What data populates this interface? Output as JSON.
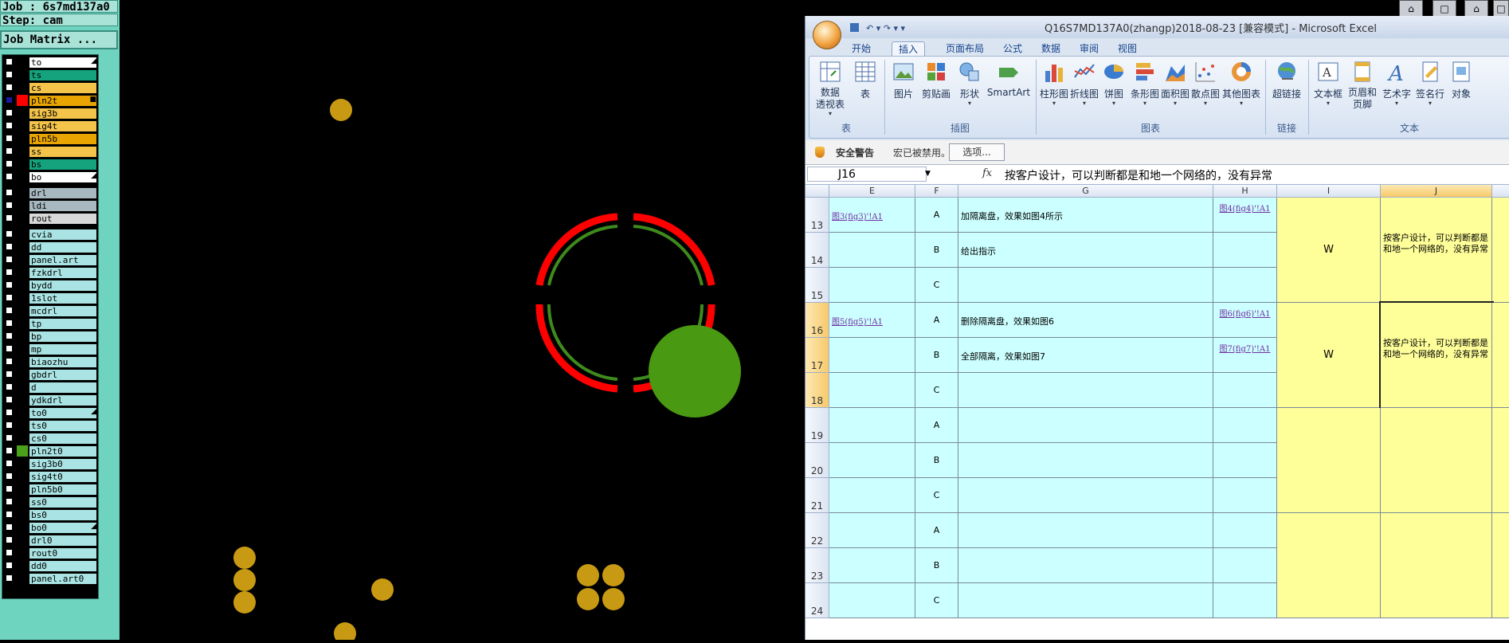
{
  "cam": {
    "job": "Job : 6s7md137a0",
    "step": "Step: cam",
    "job_matrix": "Job Matrix ...",
    "layers": [
      {
        "name": "to",
        "color": "#ffffff",
        "checked": false,
        "swatch": "",
        "arrow": "◢"
      },
      {
        "name": "ts",
        "color": "#14a37d",
        "checked": false,
        "swatch": "",
        "arrow": ""
      },
      {
        "name": "cs",
        "color": "#f3c34a",
        "checked": false,
        "swatch": "",
        "arrow": ""
      },
      {
        "name": "pln2t",
        "color": "#e8a400",
        "checked": true,
        "swatch": "#ff0000",
        "arrow": "■"
      },
      {
        "name": "sig3b",
        "color": "#f3c34a",
        "checked": false,
        "swatch": "",
        "arrow": ""
      },
      {
        "name": "sig4t",
        "color": "#f3c34a",
        "checked": false,
        "swatch": "",
        "arrow": ""
      },
      {
        "name": "pln5b",
        "color": "#e8a400",
        "checked": false,
        "swatch": "",
        "arrow": ""
      },
      {
        "name": "ss",
        "color": "#f3c34a",
        "checked": false,
        "swatch": "",
        "arrow": ""
      },
      {
        "name": "bs",
        "color": "#14a37d",
        "checked": false,
        "swatch": "",
        "arrow": ""
      },
      {
        "name": "bo",
        "color": "#ffffff",
        "checked": false,
        "swatch": "",
        "arrow": "◢"
      },
      {
        "name": "drl",
        "color": "#a8b8c0",
        "checked": false,
        "swatch": "",
        "arrow": ""
      },
      {
        "name": "ldi",
        "color": "#a8b8c0",
        "checked": false,
        "swatch": "",
        "arrow": ""
      },
      {
        "name": "rout",
        "color": "#d8d8d8",
        "checked": false,
        "swatch": "",
        "arrow": ""
      },
      {
        "name": "cvia",
        "color": "#a9e3e3",
        "checked": false,
        "swatch": "",
        "arrow": ""
      },
      {
        "name": "dd",
        "color": "#a9e3e3",
        "checked": false,
        "swatch": "",
        "arrow": ""
      },
      {
        "name": "panel.art",
        "color": "#a9e3e3",
        "checked": false,
        "swatch": "",
        "arrow": ""
      },
      {
        "name": "fzkdrl",
        "color": "#a9e3e3",
        "checked": false,
        "swatch": "",
        "arrow": ""
      },
      {
        "name": "bydd",
        "color": "#a9e3e3",
        "checked": false,
        "swatch": "",
        "arrow": ""
      },
      {
        "name": "1slot",
        "color": "#a9e3e3",
        "checked": false,
        "swatch": "",
        "arrow": ""
      },
      {
        "name": "mcdrl",
        "color": "#a9e3e3",
        "checked": false,
        "swatch": "",
        "arrow": ""
      },
      {
        "name": "tp",
        "color": "#a9e3e3",
        "checked": false,
        "swatch": "",
        "arrow": ""
      },
      {
        "name": "bp",
        "color": "#a9e3e3",
        "checked": false,
        "swatch": "",
        "arrow": ""
      },
      {
        "name": "mp",
        "color": "#a9e3e3",
        "checked": false,
        "swatch": "",
        "arrow": ""
      },
      {
        "name": "biaozhu",
        "color": "#a9e3e3",
        "checked": false,
        "swatch": "",
        "arrow": ""
      },
      {
        "name": "gbdrl",
        "color": "#a9e3e3",
        "checked": false,
        "swatch": "",
        "arrow": ""
      },
      {
        "name": "d",
        "color": "#a9e3e3",
        "checked": false,
        "swatch": "",
        "arrow": ""
      },
      {
        "name": "ydkdrl",
        "color": "#a9e3e3",
        "checked": false,
        "swatch": "",
        "arrow": ""
      },
      {
        "name": "to0",
        "color": "#a9e3e3",
        "checked": false,
        "swatch": "",
        "arrow": "◢"
      },
      {
        "name": "ts0",
        "color": "#a9e3e3",
        "checked": false,
        "swatch": "",
        "arrow": ""
      },
      {
        "name": "cs0",
        "color": "#a9e3e3",
        "checked": false,
        "swatch": "",
        "arrow": ""
      },
      {
        "name": "pln2t0",
        "color": "#a9e3e3",
        "checked": false,
        "swatch": "#4aa21a",
        "arrow": ""
      },
      {
        "name": "sig3b0",
        "color": "#a9e3e3",
        "checked": false,
        "swatch": "",
        "arrow": ""
      },
      {
        "name": "sig4t0",
        "color": "#a9e3e3",
        "checked": false,
        "swatch": "",
        "arrow": ""
      },
      {
        "name": "pln5b0",
        "color": "#a9e3e3",
        "checked": false,
        "swatch": "",
        "arrow": ""
      },
      {
        "name": "ss0",
        "color": "#a9e3e3",
        "checked": false,
        "swatch": "",
        "arrow": ""
      },
      {
        "name": "bs0",
        "color": "#a9e3e3",
        "checked": false,
        "swatch": "",
        "arrow": ""
      },
      {
        "name": "bo0",
        "color": "#a9e3e3",
        "checked": false,
        "swatch": "",
        "arrow": "◢"
      },
      {
        "name": "drl0",
        "color": "#a9e3e3",
        "checked": false,
        "swatch": "",
        "arrow": ""
      },
      {
        "name": "rout0",
        "color": "#a9e3e3",
        "checked": false,
        "swatch": "",
        "arrow": ""
      },
      {
        "name": "dd0",
        "color": "#a9e3e3",
        "checked": false,
        "swatch": "",
        "arrow": ""
      },
      {
        "name": "panel.art0",
        "color": "#a9e3e3",
        "checked": false,
        "swatch": "",
        "arrow": ""
      }
    ]
  },
  "excel": {
    "title": "Q16S7MD137A0(zhangp)2018-08-23  [兼容模式] - Microsoft Excel",
    "tabs": [
      "开始",
      "插入",
      "页面布局",
      "公式",
      "数据",
      "审阅",
      "视图"
    ],
    "active_tab": "插入",
    "ribbon": {
      "pivot": "数据\n透视表",
      "table": "表",
      "picture": "图片",
      "clipart": "剪贴画",
      "shapes": "形状",
      "smartart": "SmartArt",
      "column": "柱形图",
      "line": "折线图",
      "pie": "饼图",
      "bar": "条形图",
      "area": "面积图",
      "scatter": "散点图",
      "other": "其他图表",
      "hyperlink": "超链接",
      "textbox": "文本框",
      "header": "页眉和\n页脚",
      "wordart": "艺术字",
      "signature": "签名行",
      "object": "对象",
      "groups": {
        "tables": "表",
        "illustrations": "插图",
        "charts": "图表",
        "links": "链接",
        "text": "文本"
      }
    },
    "security": {
      "title": "安全警告",
      "message": "宏已被禁用。",
      "button": "选项..."
    },
    "name_box": "J16",
    "formula": "按客户设计，可以判断都是和地一个网络的，没有异常",
    "columns": [
      "E",
      "F",
      "G",
      "H",
      "I",
      "J"
    ],
    "rows": [
      {
        "num": "13",
        "E": "图3(fig3)'!A1",
        "F": "A",
        "G": "加隔离盘，效果如图4所示",
        "H": "图4(fig4)'!A1"
      },
      {
        "num": "14",
        "E": "",
        "F": "B",
        "G": "给出指示",
        "H": ""
      },
      {
        "num": "15",
        "E": "",
        "F": "C",
        "G": "",
        "H": ""
      },
      {
        "num": "16",
        "E": "图5(fig5)'!A1",
        "F": "A",
        "G": "删除隔离盘，效果如图6",
        "H": "图6(fig6)'!A1"
      },
      {
        "num": "17",
        "E": "",
        "F": "B",
        "G": "全部隔离，效果如图7",
        "H": "图7(fig7)'!A1"
      },
      {
        "num": "18",
        "E": "",
        "F": "C",
        "G": "",
        "H": ""
      },
      {
        "num": "19",
        "E": "",
        "F": "A",
        "G": "",
        "H": ""
      },
      {
        "num": "20",
        "E": "",
        "F": "B",
        "G": "",
        "H": ""
      },
      {
        "num": "21",
        "E": "",
        "F": "C",
        "G": "",
        "H": ""
      },
      {
        "num": "22",
        "E": "",
        "F": "A",
        "G": "",
        "H": ""
      },
      {
        "num": "23",
        "E": "",
        "F": "B",
        "G": "",
        "H": ""
      },
      {
        "num": "24",
        "E": "",
        "F": "C",
        "G": "",
        "H": ""
      }
    ],
    "merged": [
      {
        "I": "W",
        "J": "按客户设计，可以判断都是和地一个网络的，没有异常"
      },
      {
        "I": "W",
        "J": "按客户设计，可以判断都是和地一个网络的，没有异常"
      }
    ]
  }
}
